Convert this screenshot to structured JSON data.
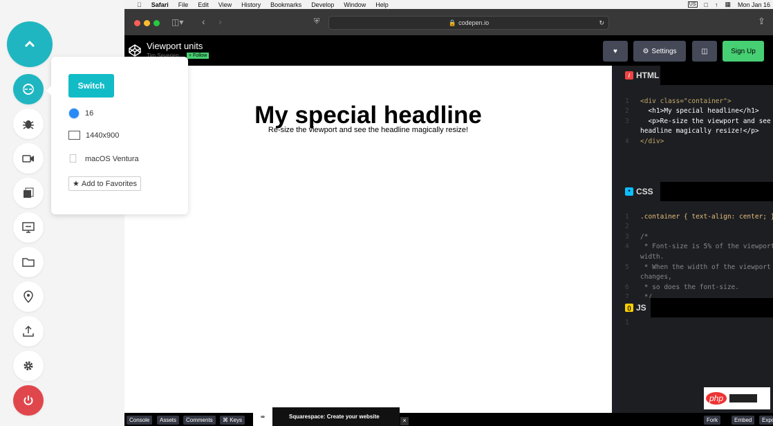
{
  "menubar": {
    "items": [
      "Safari",
      "File",
      "Edit",
      "View",
      "History",
      "Bookmarks",
      "Develop",
      "Window",
      "Help"
    ],
    "input_source": "US",
    "datetime": "Mon Jan 16"
  },
  "browser": {
    "url": "codepen.io"
  },
  "codepen": {
    "title": "Viewport units",
    "author": "Tim Severien",
    "follow": "+ Follow",
    "settings": "Settings",
    "signup": "Sign Up"
  },
  "preview": {
    "headline": "My special headline",
    "paragraph": "Re-size the viewport and see the headline magically resize!"
  },
  "editors": {
    "html": {
      "label": "HTML",
      "lines": [
        "<div class=\"container\">",
        "  <h1>My special headline</h1>",
        "  <p>Re-size the viewport and see the",
        "headline magically resize!</p>",
        "</div>"
      ]
    },
    "css": {
      "label": "CSS",
      "lines": [
        ".container { text-align: center; }",
        "",
        "/*",
        " * Font-size is 5% of the viewport",
        "width.",
        " * When the width of the viewport",
        "changes,",
        " * so does the font-size.",
        " */"
      ]
    },
    "js": {
      "label": "JS"
    }
  },
  "bottom": {
    "console": "Console",
    "assets": "Assets",
    "comments": "Comments",
    "keys": "⌘ Keys",
    "ad": "Squarespace: Create your website",
    "fork": "Fork",
    "embed": "Embed",
    "export": "Export"
  },
  "popup": {
    "switch": "Switch",
    "browser_version": "16",
    "resolution": "1440x900",
    "os": "macOS Ventura",
    "favorites": "Add to Favorites"
  },
  "colors": {
    "teal": "#1fb6c1",
    "power": "#e0474c",
    "signup": "#47cf73"
  }
}
